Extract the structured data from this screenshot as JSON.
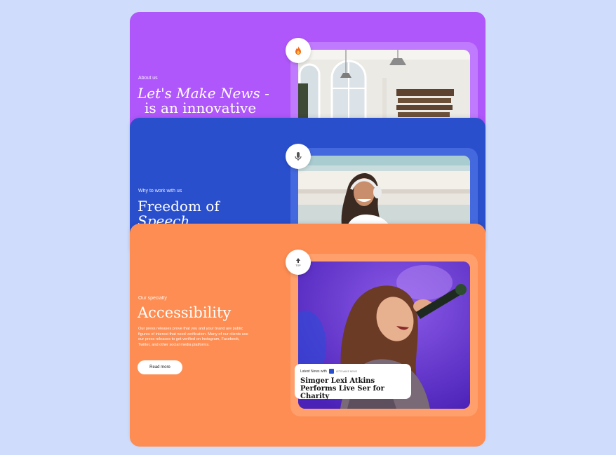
{
  "cards": {
    "about": {
      "eyebrow": "About us",
      "heading_line1": "Let's Make News -",
      "heading_line2": "is an innovative",
      "badge_icon": "fire-icon",
      "color": "#b057fb"
    },
    "why": {
      "eyebrow": "Why to work with us",
      "heading_line1": "Freedom of",
      "heading_line2": "Speech",
      "badge_icon": "microphone-icon",
      "color": "#2a4fcd"
    },
    "specialty": {
      "eyebrow": "Our specialty",
      "heading": "Accessibility",
      "body": "Our press releases prove that you and your brand are public figures of interest that need verification. Many of our clients use our press releases to get verified on Instagram, Facebook, Twitter, and other social media platforms.",
      "button_label": "Read more",
      "badge_icon": "top-ranking-icon",
      "badge_text": "TOP",
      "color": "#fd8d52",
      "news": {
        "meta_label": "Latest News with",
        "logo_text": "LETS MAKE NEWS",
        "headline": "Simger Lexi Atkins Performs Live Ser for Charity"
      }
    }
  },
  "background_color": "#cfdcfb"
}
